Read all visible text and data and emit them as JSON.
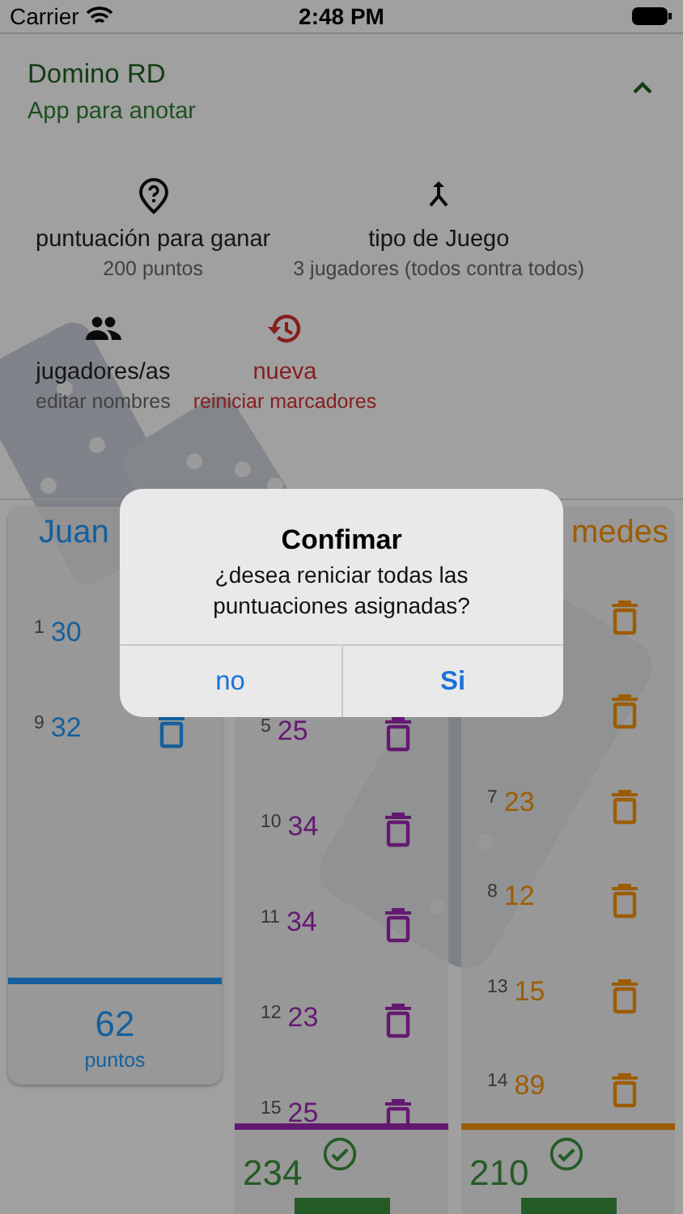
{
  "status_bar": {
    "carrier": "Carrier",
    "time": "2:48 PM"
  },
  "header": {
    "title": "Domino RD",
    "subtitle": "App para anotar",
    "expanded": true
  },
  "options": [
    {
      "label": "puntuación para ganar",
      "sub": "200 puntos",
      "kind": "normal"
    },
    {
      "label": "tipo de Juego",
      "sub": "3 jugadores (todos contra todos)",
      "kind": "normal"
    },
    {
      "label": "jugadores/as",
      "sub": "editar nombres",
      "kind": "normal"
    },
    {
      "label": "nueva",
      "sub": "reiniciar marcadores",
      "kind": "danger"
    }
  ],
  "columns": [
    {
      "name": "Juan",
      "color": "#15609c",
      "winner": false,
      "total": "62",
      "total_label": "puntos",
      "rows": [
        {
          "index": "1",
          "points": "30",
          "trash": false
        },
        {
          "index": "9",
          "points": "32",
          "trash": true
        }
      ]
    },
    {
      "color": "#641971",
      "winner": true,
      "total": "234",
      "rows": [
        {
          "index": "5",
          "points": "25",
          "trash": true
        },
        {
          "index": "10",
          "points": "34",
          "trash": true
        },
        {
          "index": "11",
          "points": "34",
          "trash": true
        },
        {
          "index": "12",
          "points": "23",
          "trash": true
        },
        {
          "index": "15",
          "points": "25",
          "trash": true
        }
      ]
    },
    {
      "name": "medes",
      "color": "#9c5d00",
      "winner": true,
      "total": "210",
      "rows": [
        {
          "trash": true
        },
        {
          "trash": true
        },
        {
          "index": "7",
          "points": "23",
          "trash": true
        },
        {
          "index": "8",
          "points": "12",
          "trash": true
        },
        {
          "index": "13",
          "points": "15",
          "trash": true
        },
        {
          "index": "14",
          "points": "89",
          "trash": true
        }
      ]
    }
  ],
  "dialog": {
    "title": "Confimar",
    "message": "¿desea reniciar todas las puntuaciones asignadas?",
    "buttons": [
      {
        "label": "no",
        "primary": false
      },
      {
        "label": "Si",
        "primary": true
      }
    ]
  }
}
